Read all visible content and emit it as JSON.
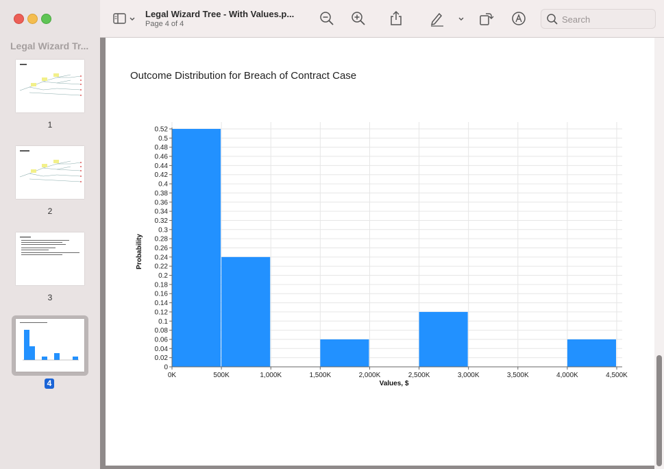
{
  "sidebar": {
    "title": "Legal Wizard Tr...",
    "pages": [
      {
        "label": "1"
      },
      {
        "label": "2"
      },
      {
        "label": "3"
      },
      {
        "label": "4"
      }
    ],
    "selected_page": "4"
  },
  "toolbar": {
    "doc_title": "Legal Wizard Tree - With Values.p...",
    "page_info": "Page 4 of 4",
    "search_placeholder": "Search"
  },
  "chart_data": {
    "type": "bar",
    "title": "Outcome Distribution for Breach of Contract Case",
    "xlabel": "Values, $",
    "ylabel": "Probability",
    "xlim": [
      0,
      4500
    ],
    "ylim": [
      0,
      0.52
    ],
    "x_ticks": [
      "0K",
      "500K",
      "1,000K",
      "1,500K",
      "2,000K",
      "2,500K",
      "3,000K",
      "3,500K",
      "4,000K",
      "4,500K"
    ],
    "y_ticks": [
      "0",
      "0.02",
      "0.04",
      "0.06",
      "0.08",
      "0.1",
      "0.12",
      "0.14",
      "0.16",
      "0.18",
      "0.2",
      "0.22",
      "0.24",
      "0.26",
      "0.28",
      "0.3",
      "0.32",
      "0.34",
      "0.36",
      "0.38",
      "0.4",
      "0.42",
      "0.44",
      "0.46",
      "0.48",
      "0.5",
      "0.52"
    ],
    "bins": [
      {
        "x0": 0,
        "x1": 500,
        "value": 0.52
      },
      {
        "x0": 500,
        "x1": 1000,
        "value": 0.24
      },
      {
        "x0": 1500,
        "x1": 2000,
        "value": 0.06
      },
      {
        "x0": 2500,
        "x1": 3000,
        "value": 0.12
      },
      {
        "x0": 4000,
        "x1": 4500,
        "value": 0.06
      }
    ],
    "bar_color": "#2291ff",
    "grid": true
  }
}
